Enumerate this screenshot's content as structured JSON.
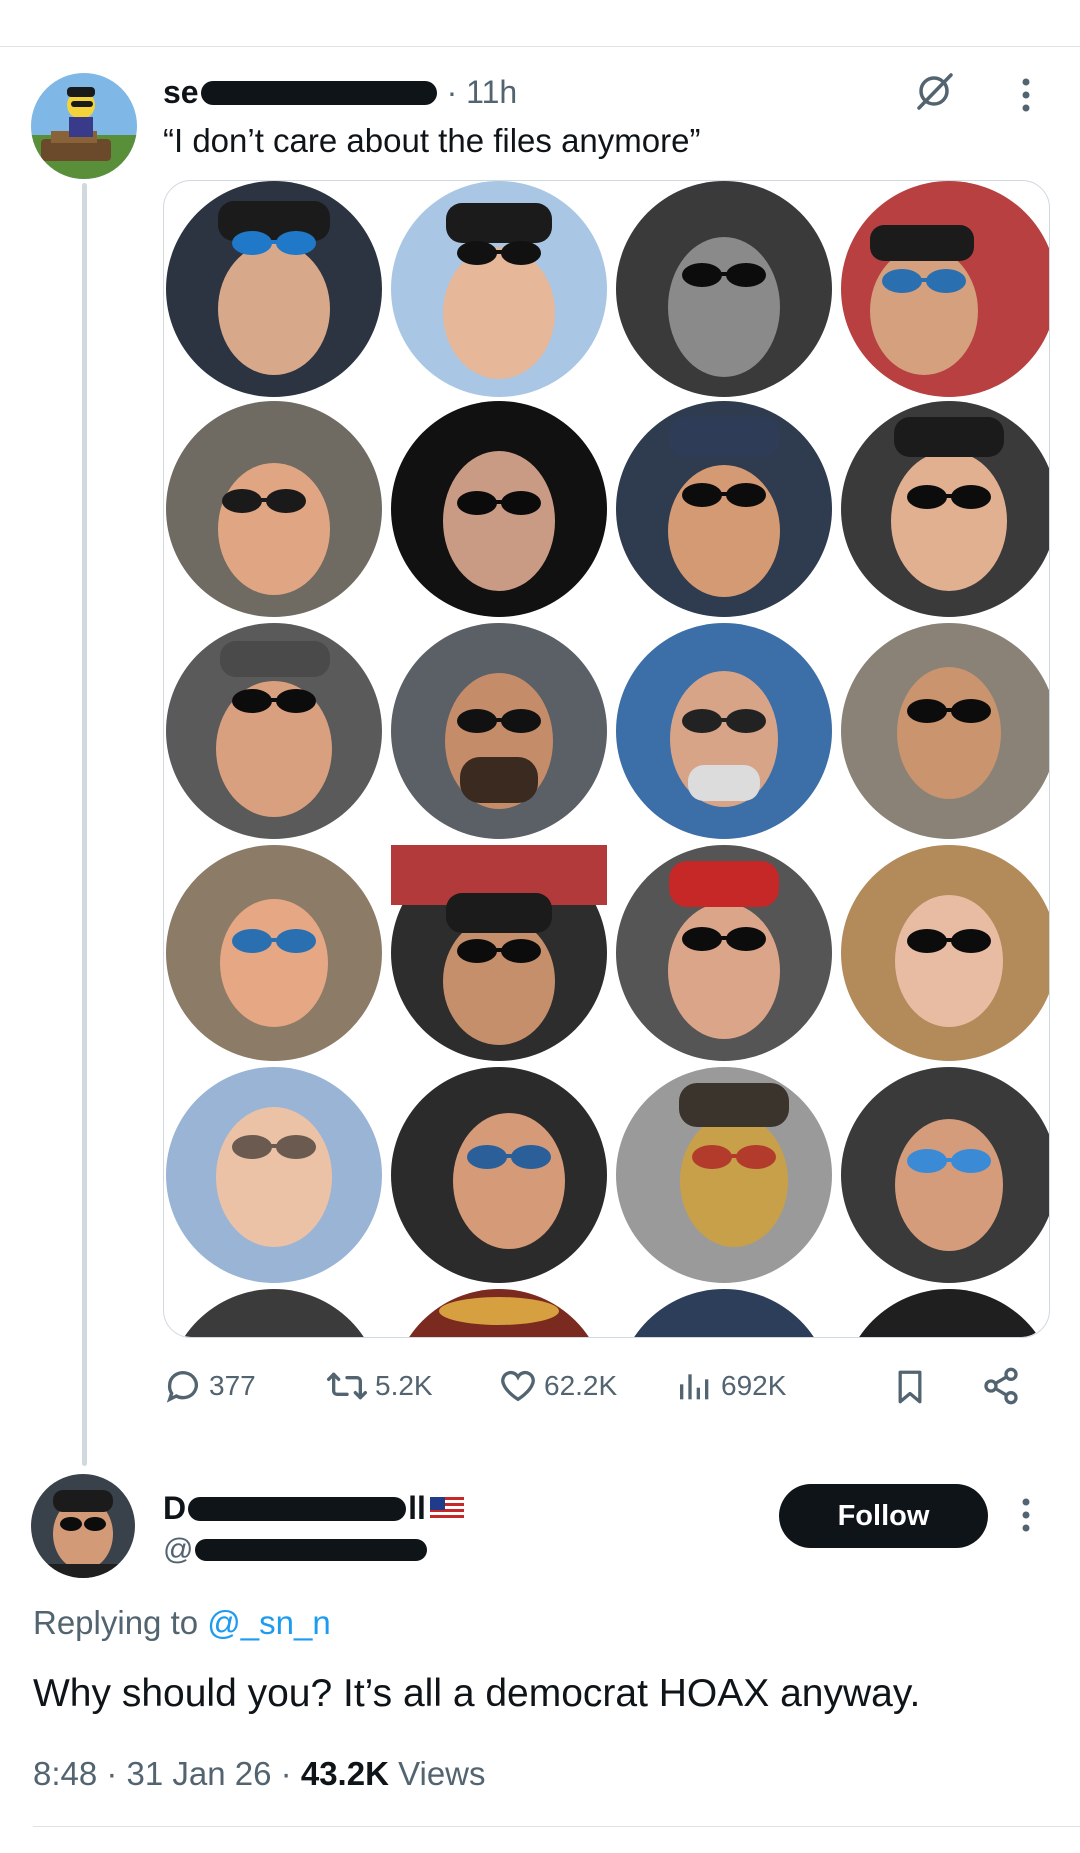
{
  "post": {
    "name_prefix": "se",
    "time": "· 11h",
    "text": "“I don’t care about the files anymore”",
    "grid_image_alt": "grid of 20 circular profile selfies of people wearing sunglasses"
  },
  "stats": {
    "replies": "377",
    "reposts": "5.2K",
    "likes": "62.2K",
    "views": "692K"
  },
  "reply": {
    "name_prefix": "D",
    "name_suffix": "ll",
    "handle_prefix": "@",
    "follow_label": "Follow",
    "replying_to_label": "Replying to",
    "replying_to_handle": "@_sn_n",
    "text": "Why should you? It’s all a democrat HOAX anyway.",
    "timestamp": "8:48 · 31 Jan 26 ·",
    "views_count": "43.2K",
    "views_label": "Views"
  },
  "icons": {
    "grok": "grok-icon",
    "more": "more-vertical-icon",
    "reply": "reply-icon",
    "repost": "repost-icon",
    "like": "heart-icon",
    "views": "views-icon",
    "bookmark": "bookmark-icon",
    "share": "share-icon",
    "flag": "us-flag-icon"
  },
  "colors": {
    "accent": "#1d9bf0",
    "text": "#0f1419",
    "muted": "#536471",
    "divider": "#cfd9de"
  }
}
